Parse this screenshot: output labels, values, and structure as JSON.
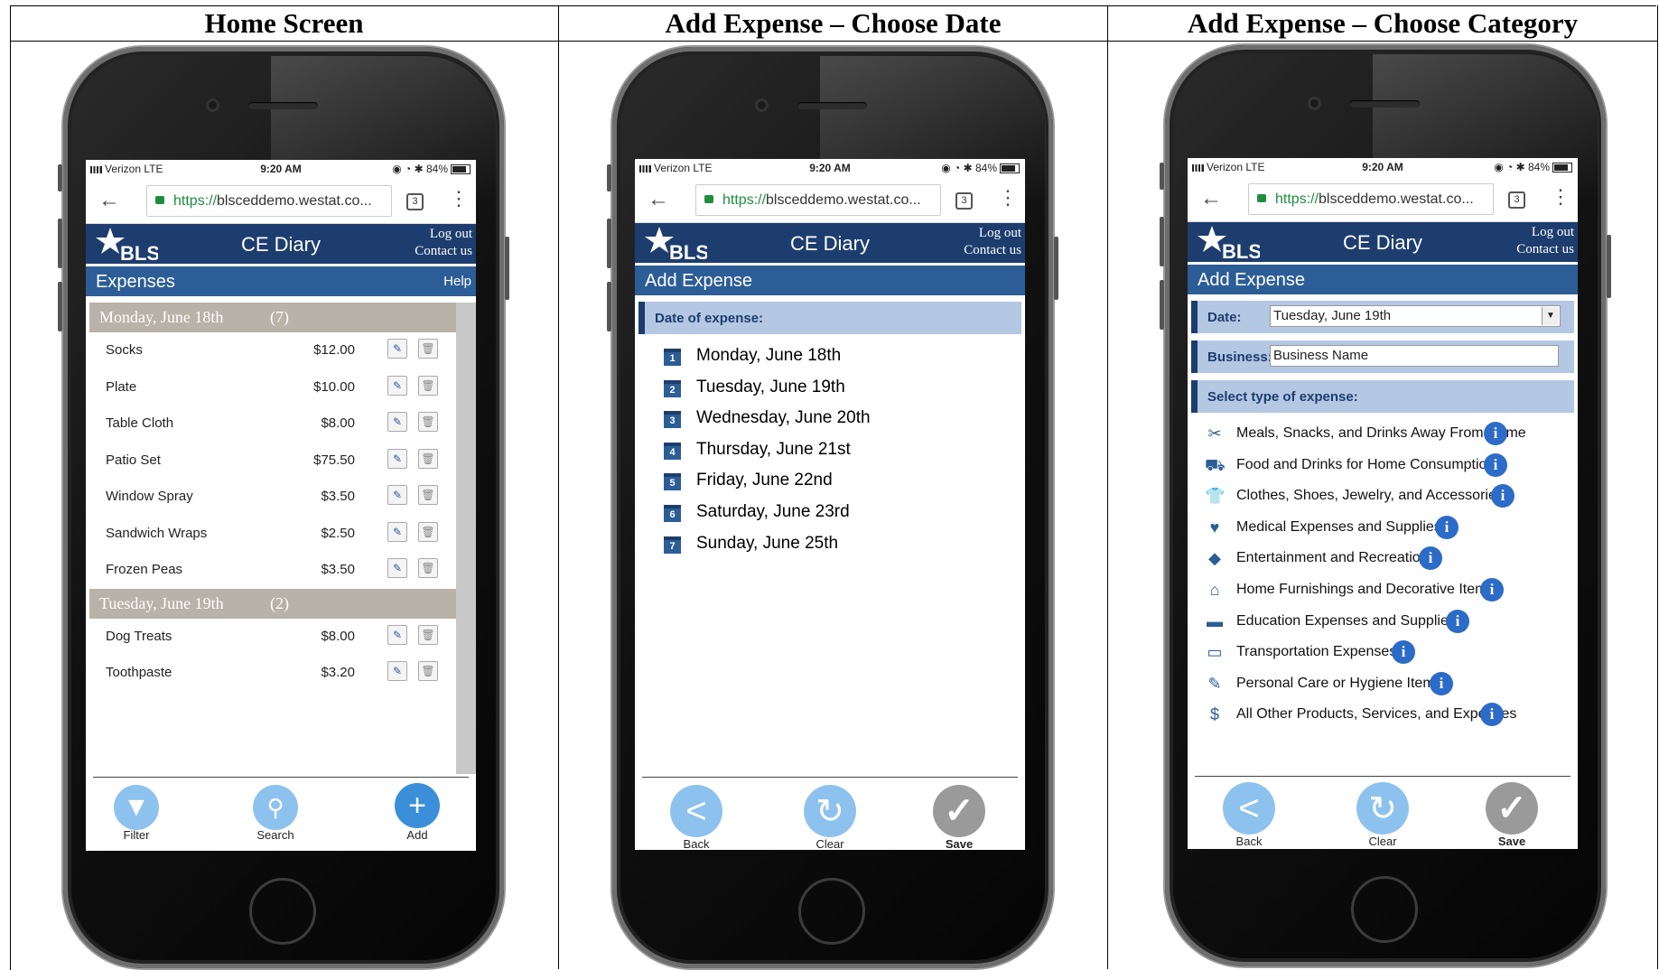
{
  "panels": [
    {
      "heading": "Home Screen"
    },
    {
      "heading": "Add Expense – Choose Date"
    },
    {
      "heading": "Add Expense – Choose Category"
    }
  ],
  "status": {
    "carrier": "Verizon  LTE",
    "time": "9:20 AM",
    "battery": "84%"
  },
  "browser": {
    "url_proto": "https://",
    "url_rest": "blsceddemo.westat.co...",
    "tabs_count": "3"
  },
  "app": {
    "logo": "BLS",
    "title": "CE Diary",
    "logout": "Log out",
    "contact": "Contact us"
  },
  "home": {
    "section_title": "Expenses",
    "help": "Help",
    "groups": [
      {
        "day": "Monday, June 18th",
        "count": "(7)",
        "items": [
          {
            "name": "Socks",
            "amount": "$12.00"
          },
          {
            "name": "Plate",
            "amount": "$10.00"
          },
          {
            "name": "Table Cloth",
            "amount": "$8.00"
          },
          {
            "name": "Patio Set",
            "amount": "$75.50"
          },
          {
            "name": "Window Spray",
            "amount": "$3.50"
          },
          {
            "name": "Sandwich Wraps",
            "amount": "$2.50"
          },
          {
            "name": "Frozen Peas",
            "amount": "$3.50"
          }
        ]
      },
      {
        "day": "Tuesday, June 19th",
        "count": "(2)",
        "items": [
          {
            "name": "Dog Treats",
            "amount": "$8.00"
          },
          {
            "name": "Toothpaste",
            "amount": "$3.20"
          }
        ]
      }
    ],
    "nav": {
      "filter": "Filter",
      "search": "Search",
      "add": "Add"
    }
  },
  "date_screen": {
    "section_title": "Add Expense",
    "prompt": "Date of expense:",
    "dates": [
      {
        "num": "1",
        "label": "Monday, June 18th"
      },
      {
        "num": "2",
        "label": "Tuesday, June 19th"
      },
      {
        "num": "3",
        "label": "Wednesday, June 20th"
      },
      {
        "num": "4",
        "label": "Thursday, June 21st"
      },
      {
        "num": "5",
        "label": "Friday, June 22nd"
      },
      {
        "num": "6",
        "label": "Saturday, June 23rd"
      },
      {
        "num": "7",
        "label": "Sunday, June 25th"
      }
    ],
    "nav": {
      "back": "Back",
      "clear": "Clear",
      "save": "Save"
    }
  },
  "category_screen": {
    "section_title": "Add Expense",
    "date_label": "Date:",
    "date_value": "Tuesday, June 19th",
    "business_label": "Business:",
    "business_value": "Business Name",
    "prompt": "Select type of expense:",
    "categories": [
      {
        "icon": "utensils-icon",
        "glyph": "✂",
        "label": "Meals, Snacks, and Drinks Away From Home"
      },
      {
        "icon": "cart-icon",
        "glyph": "⛟",
        "label": "Food and Drinks for Home Consumption"
      },
      {
        "icon": "shirt-icon",
        "glyph": "👕",
        "label": "Clothes, Shoes, Jewelry, and Accessories"
      },
      {
        "icon": "heart-icon",
        "glyph": "♥",
        "label": "Medical Expenses and Supplies"
      },
      {
        "icon": "ticket-icon",
        "glyph": "◆",
        "label": "Entertainment and Recreation"
      },
      {
        "icon": "home-icon",
        "glyph": "⌂",
        "label": "Home Furnishings and Decorative Items"
      },
      {
        "icon": "graduation-cap-icon",
        "glyph": "▬",
        "label": "Education Expenses and Supplies"
      },
      {
        "icon": "car-icon",
        "glyph": "▭",
        "label": "Transportation Expenses"
      },
      {
        "icon": "brush-icon",
        "glyph": "✎",
        "label": "Personal Care or Hygiene Items"
      },
      {
        "icon": "dollar-icon",
        "glyph": "$",
        "label": "All Other Products, Services, and Expenses"
      }
    ],
    "nav": {
      "back": "Back",
      "clear": "Clear",
      "save": "Save"
    }
  },
  "colors": {
    "navy": "#1d3d6e",
    "blue": "#2c5d96",
    "light_blue": "#b4c7e3",
    "day_gray": "#b8b2a8",
    "button_blue": "#8ec2ee",
    "button_gray": "#9a9a9a"
  }
}
